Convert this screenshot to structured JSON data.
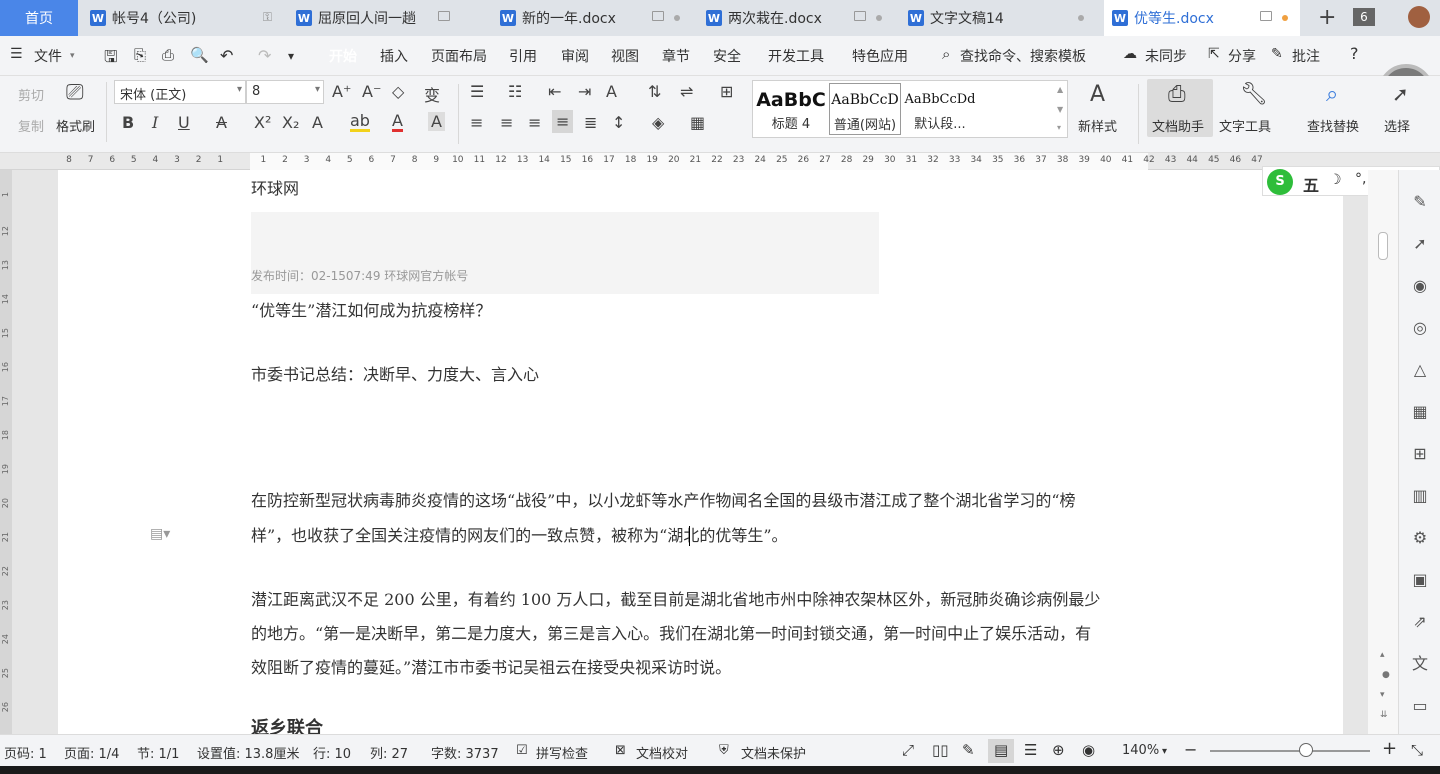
{
  "tabs": [
    {
      "label": "首页"
    },
    {
      "label": "帐号4（公司)"
    },
    {
      "label": "屈原回人间一趟"
    },
    {
      "label": "新的一年.docx"
    },
    {
      "label": "两次栽在.docx"
    },
    {
      "label": "文字文稿14"
    },
    {
      "label": "优等生.docx"
    }
  ],
  "tab_count": "6",
  "menu": {
    "file": "文件",
    "items": [
      "开始",
      "插入",
      "页面布局",
      "引用",
      "审阅",
      "视图",
      "章节",
      "安全",
      "开发工具",
      "特色应用"
    ],
    "search": "查找命令、搜索模板",
    "sync": "未同步",
    "share": "分享",
    "comment": "批注"
  },
  "ribbon": {
    "cut": "剪切",
    "copy": "复制",
    "format_painter": "格式刷",
    "font_name": "宋体 (正文)",
    "font_size": "8",
    "styles": [
      {
        "preview": "AaBbC",
        "name": "标题 4"
      },
      {
        "preview": "AaBbCcD",
        "name": "普通(网站)"
      },
      {
        "preview": "AaBbCcDd",
        "name": "默认段..."
      }
    ],
    "new_style": "新样式",
    "doc_assistant": "文档助手",
    "text_tools": "文字工具",
    "find_replace": "查找替换",
    "select": "选择"
  },
  "ruler": {
    "labels": [
      "8",
      "7",
      "6",
      "5",
      "4",
      "3",
      "2",
      "1",
      "",
      "1",
      "2",
      "3",
      "4",
      "5",
      "6",
      "7",
      "8",
      "9",
      "10",
      "11",
      "12",
      "13",
      "14",
      "15",
      "16",
      "17",
      "18",
      "19",
      "20",
      "21",
      "22",
      "23",
      "24",
      "25",
      "26",
      "27",
      "28",
      "29",
      "30",
      "31",
      "32",
      "33",
      "34",
      "35",
      "36",
      "37",
      "38",
      "39",
      "40",
      "41",
      "42",
      "43",
      "44",
      "45",
      "46",
      "47"
    ]
  },
  "vruler": {
    "labels": [
      "1",
      "12",
      "13",
      "14",
      "15",
      "16",
      "17",
      "18",
      "19",
      "20",
      "21",
      "22",
      "23",
      "24",
      "25",
      "26"
    ]
  },
  "document": {
    "source": "环球网",
    "publish": "发布时间：02-1507:49 环球网官方帐号",
    "subtitle": "“优等生”潜江如何成为抗疫榜样？",
    "summary": "市委书记总结：决断早、力度大、言入心",
    "para1_line1": "在防控新型冠状病毒肺炎疫情的这场“战役”中，以小龙虾等水产作物闻名全国的县级市潜江成了整个湖北省学习的“榜",
    "para1_line2": "样”，也收获了全国关注疫情的网友们的一致点赞，被称为“湖北的优等生”。",
    "para2_line1": "潜江距离武汉不足 200 公里，有着约 100 万人口，截至目前是湖北省地市州中除神农架林区外，新冠肺炎确诊病例最少",
    "para2_line2": "的地方。“第一是决断早，第二是力度大，第三是言入心。我们在湖北第一时间封锁交通，第一时间中止了娱乐活动，有",
    "para2_line3": "效阻断了疫情的蔓延。”潜江市市委书记吴祖云在接受央视采访时说。",
    "heading_cut": "返乡联合"
  },
  "ime": {
    "mode": "五"
  },
  "status": {
    "page_no": "页码: 1",
    "pages": "页面: 1/4",
    "section": "节: 1/1",
    "setting": "设置值: 13.8厘米",
    "row": "行: 10",
    "col": "列: 27",
    "words": "字数: 3737",
    "spell": "拼写检查",
    "proof": "文档校对",
    "protect": "文档未保护",
    "zoom": "140%",
    "zoom_level": 0.6
  },
  "colors": {
    "accent": "#4a86e8",
    "home_tab": "#4a86e8",
    "start_pill": "#5b8fe8",
    "wps_word": "#2f6fd6"
  }
}
